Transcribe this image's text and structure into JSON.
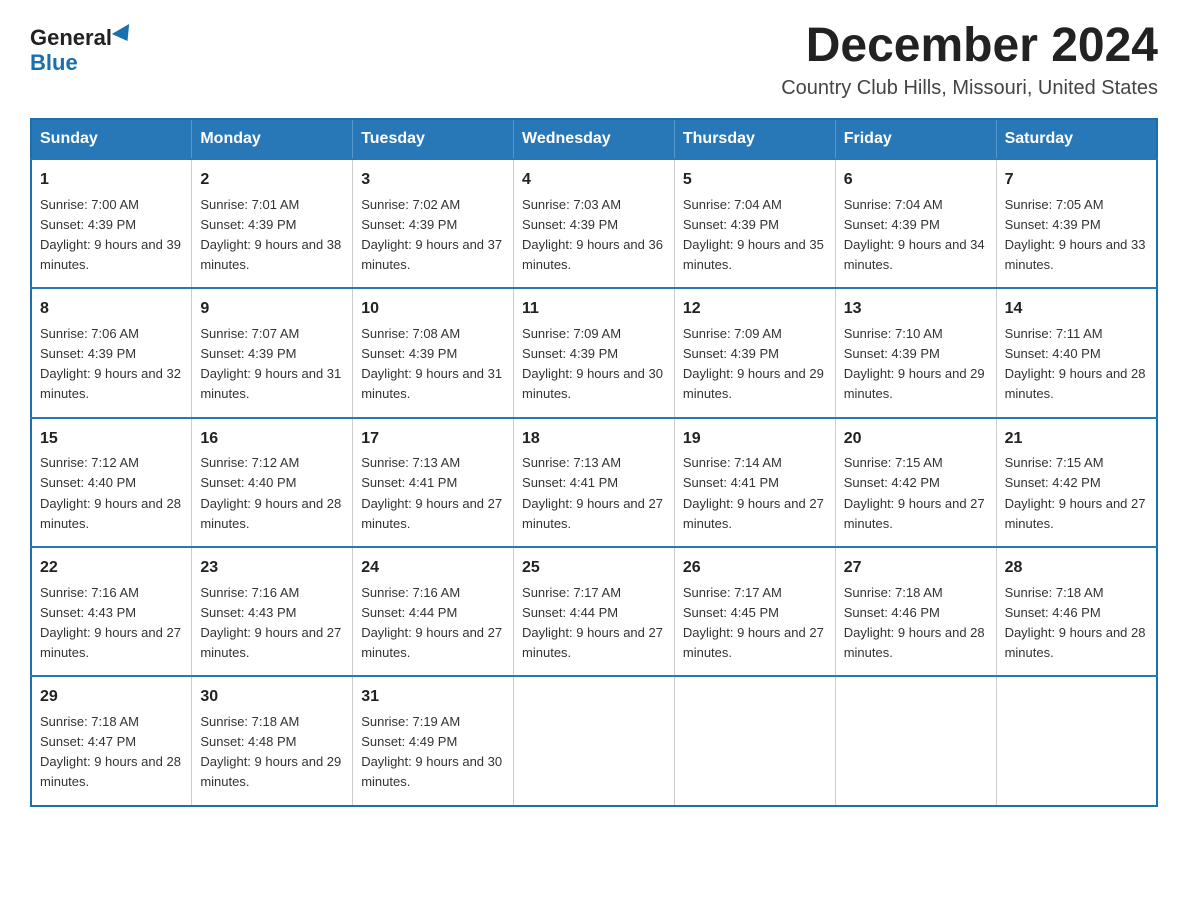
{
  "logo": {
    "general": "General",
    "blue": "Blue"
  },
  "title": "December 2024",
  "subtitle": "Country Club Hills, Missouri, United States",
  "days_of_week": [
    "Sunday",
    "Monday",
    "Tuesday",
    "Wednesday",
    "Thursday",
    "Friday",
    "Saturday"
  ],
  "weeks": [
    [
      {
        "day": "1",
        "sunrise": "7:00 AM",
        "sunset": "4:39 PM",
        "daylight": "9 hours and 39 minutes."
      },
      {
        "day": "2",
        "sunrise": "7:01 AM",
        "sunset": "4:39 PM",
        "daylight": "9 hours and 38 minutes."
      },
      {
        "day": "3",
        "sunrise": "7:02 AM",
        "sunset": "4:39 PM",
        "daylight": "9 hours and 37 minutes."
      },
      {
        "day": "4",
        "sunrise": "7:03 AM",
        "sunset": "4:39 PM",
        "daylight": "9 hours and 36 minutes."
      },
      {
        "day": "5",
        "sunrise": "7:04 AM",
        "sunset": "4:39 PM",
        "daylight": "9 hours and 35 minutes."
      },
      {
        "day": "6",
        "sunrise": "7:04 AM",
        "sunset": "4:39 PM",
        "daylight": "9 hours and 34 minutes."
      },
      {
        "day": "7",
        "sunrise": "7:05 AM",
        "sunset": "4:39 PM",
        "daylight": "9 hours and 33 minutes."
      }
    ],
    [
      {
        "day": "8",
        "sunrise": "7:06 AM",
        "sunset": "4:39 PM",
        "daylight": "9 hours and 32 minutes."
      },
      {
        "day": "9",
        "sunrise": "7:07 AM",
        "sunset": "4:39 PM",
        "daylight": "9 hours and 31 minutes."
      },
      {
        "day": "10",
        "sunrise": "7:08 AM",
        "sunset": "4:39 PM",
        "daylight": "9 hours and 31 minutes."
      },
      {
        "day": "11",
        "sunrise": "7:09 AM",
        "sunset": "4:39 PM",
        "daylight": "9 hours and 30 minutes."
      },
      {
        "day": "12",
        "sunrise": "7:09 AM",
        "sunset": "4:39 PM",
        "daylight": "9 hours and 29 minutes."
      },
      {
        "day": "13",
        "sunrise": "7:10 AM",
        "sunset": "4:39 PM",
        "daylight": "9 hours and 29 minutes."
      },
      {
        "day": "14",
        "sunrise": "7:11 AM",
        "sunset": "4:40 PM",
        "daylight": "9 hours and 28 minutes."
      }
    ],
    [
      {
        "day": "15",
        "sunrise": "7:12 AM",
        "sunset": "4:40 PM",
        "daylight": "9 hours and 28 minutes."
      },
      {
        "day": "16",
        "sunrise": "7:12 AM",
        "sunset": "4:40 PM",
        "daylight": "9 hours and 28 minutes."
      },
      {
        "day": "17",
        "sunrise": "7:13 AM",
        "sunset": "4:41 PM",
        "daylight": "9 hours and 27 minutes."
      },
      {
        "day": "18",
        "sunrise": "7:13 AM",
        "sunset": "4:41 PM",
        "daylight": "9 hours and 27 minutes."
      },
      {
        "day": "19",
        "sunrise": "7:14 AM",
        "sunset": "4:41 PM",
        "daylight": "9 hours and 27 minutes."
      },
      {
        "day": "20",
        "sunrise": "7:15 AM",
        "sunset": "4:42 PM",
        "daylight": "9 hours and 27 minutes."
      },
      {
        "day": "21",
        "sunrise": "7:15 AM",
        "sunset": "4:42 PM",
        "daylight": "9 hours and 27 minutes."
      }
    ],
    [
      {
        "day": "22",
        "sunrise": "7:16 AM",
        "sunset": "4:43 PM",
        "daylight": "9 hours and 27 minutes."
      },
      {
        "day": "23",
        "sunrise": "7:16 AM",
        "sunset": "4:43 PM",
        "daylight": "9 hours and 27 minutes."
      },
      {
        "day": "24",
        "sunrise": "7:16 AM",
        "sunset": "4:44 PM",
        "daylight": "9 hours and 27 minutes."
      },
      {
        "day": "25",
        "sunrise": "7:17 AM",
        "sunset": "4:44 PM",
        "daylight": "9 hours and 27 minutes."
      },
      {
        "day": "26",
        "sunrise": "7:17 AM",
        "sunset": "4:45 PM",
        "daylight": "9 hours and 27 minutes."
      },
      {
        "day": "27",
        "sunrise": "7:18 AM",
        "sunset": "4:46 PM",
        "daylight": "9 hours and 28 minutes."
      },
      {
        "day": "28",
        "sunrise": "7:18 AM",
        "sunset": "4:46 PM",
        "daylight": "9 hours and 28 minutes."
      }
    ],
    [
      {
        "day": "29",
        "sunrise": "7:18 AM",
        "sunset": "4:47 PM",
        "daylight": "9 hours and 28 minutes."
      },
      {
        "day": "30",
        "sunrise": "7:18 AM",
        "sunset": "4:48 PM",
        "daylight": "9 hours and 29 minutes."
      },
      {
        "day": "31",
        "sunrise": "7:19 AM",
        "sunset": "4:49 PM",
        "daylight": "9 hours and 30 minutes."
      },
      null,
      null,
      null,
      null
    ]
  ]
}
